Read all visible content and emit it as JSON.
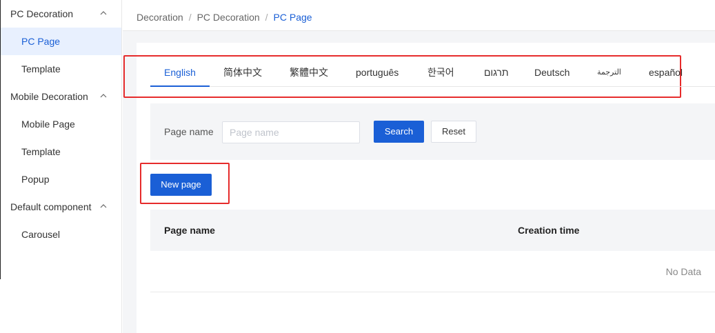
{
  "sidebar": {
    "groups": [
      {
        "label": "PC Decoration",
        "items": [
          "PC Page",
          "Template"
        ]
      },
      {
        "label": "Mobile Decoration",
        "items": [
          "Mobile Page",
          "Template",
          "Popup"
        ]
      },
      {
        "label": "Default component",
        "items": [
          "Carousel"
        ]
      }
    ],
    "active_item": "PC Page"
  },
  "breadcrumb": {
    "items": [
      "Decoration",
      "PC Decoration",
      "PC Page"
    ],
    "separator": "/"
  },
  "tabs": {
    "items": [
      "English",
      "简体中文",
      "繁體中文",
      "português",
      "한국어",
      "תרגום",
      "Deutsch",
      "الترجمة",
      "español"
    ],
    "active": "English"
  },
  "search": {
    "label": "Page name",
    "placeholder": "Page name",
    "value": "",
    "search_button": "Search",
    "reset_button": "Reset"
  },
  "actions": {
    "new_page_button": "New page"
  },
  "table": {
    "columns": [
      "Page name",
      "Creation time"
    ],
    "rows": [],
    "empty_text": "No Data"
  },
  "colors": {
    "accent": "#1a5fd6",
    "annotation": "#e62b2b",
    "active_bg": "#e8f0fe"
  }
}
